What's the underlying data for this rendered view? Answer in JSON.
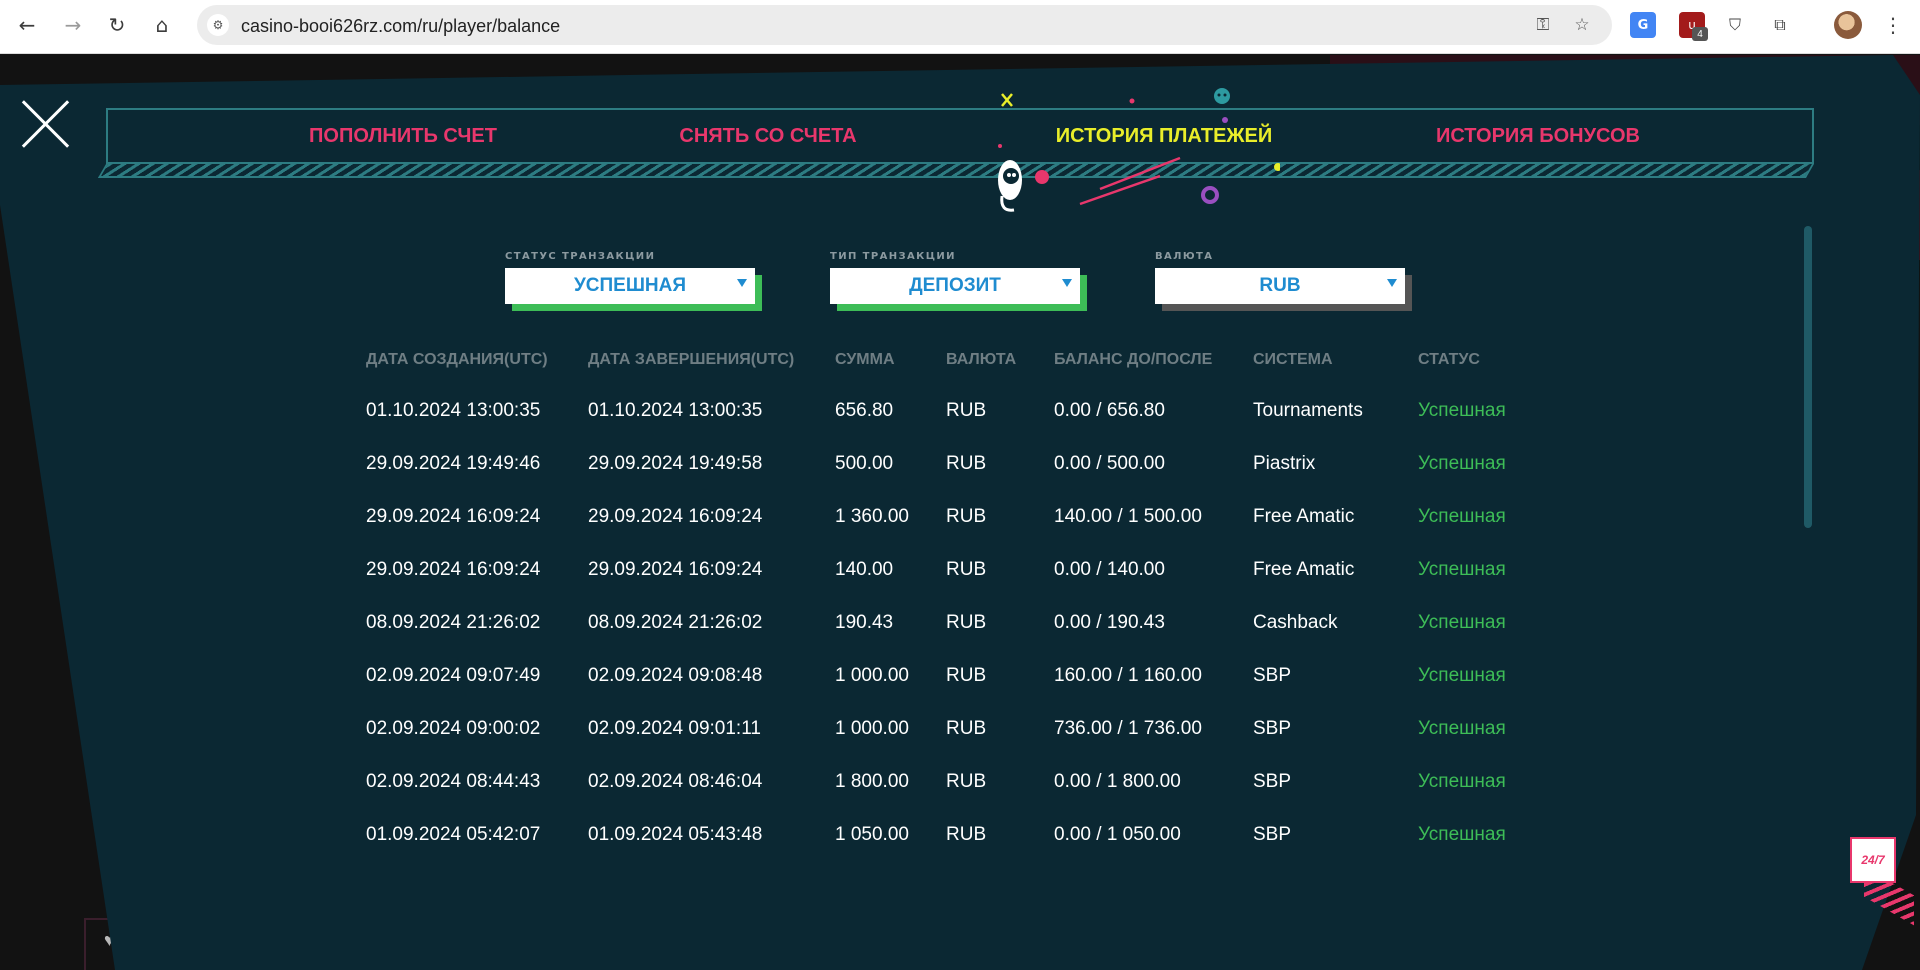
{
  "browser": {
    "url": "casino-booi626rz.com/ru/player/balance",
    "extension_badge": "4",
    "icons": [
      "back-arrow-icon",
      "forward-arrow-icon",
      "reload-icon",
      "home-icon",
      "site-info-icon",
      "key-icon",
      "star-icon",
      "translate-icon",
      "ublock-icon",
      "shield-check-icon",
      "puzzle-icon",
      "kebab-menu-icon"
    ]
  },
  "tabs": [
    {
      "label": "ПОПОЛНИТЬ СЧЕТ",
      "active": false
    },
    {
      "label": "СНЯТЬ СО СЧЕТА",
      "active": false
    },
    {
      "label": "ИСТОРИЯ ПЛАТЕЖЕЙ",
      "active": true
    },
    {
      "label": "ИСТОРИЯ БОНУСОВ",
      "active": false
    }
  ],
  "filters": {
    "status": {
      "label": "СТАТУС ТРАНЗАКЦИИ",
      "value": "УСПЕШНАЯ",
      "shadow_color": "#3dbd57"
    },
    "type": {
      "label": "ТИП ТРАНЗАКЦИИ",
      "value": "ДЕПОЗИТ",
      "shadow_color": "#3dbd57"
    },
    "currency": {
      "label": "ВАЛЮТА",
      "value": "RUB",
      "shadow_color": "#555555"
    }
  },
  "table": {
    "headers": [
      "ДАТА СОЗДАНИЯ(UTC)",
      "ДАТА ЗАВЕРШЕНИЯ(UTC)",
      "СУММА",
      "ВАЛЮТА",
      "БАЛАНС ДО/ПОСЛЕ",
      "СИСТЕМА",
      "СТАТУС"
    ],
    "rows": [
      [
        "01.10.2024 13:00:35",
        "01.10.2024 13:00:35",
        "656.80",
        "RUB",
        "0.00 / 656.80",
        "Tournaments",
        "Успешная"
      ],
      [
        "29.09.2024 19:49:46",
        "29.09.2024 19:49:58",
        "500.00",
        "RUB",
        "0.00 / 500.00",
        "Piastrix",
        "Успешная"
      ],
      [
        "29.09.2024 16:09:24",
        "29.09.2024 16:09:24",
        "1 360.00",
        "RUB",
        "140.00 / 1 500.00",
        "Free Amatic",
        "Успешная"
      ],
      [
        "29.09.2024 16:09:24",
        "29.09.2024 16:09:24",
        "140.00",
        "RUB",
        "0.00 / 140.00",
        "Free Amatic",
        "Успешная"
      ],
      [
        "08.09.2024 21:26:02",
        "08.09.2024 21:26:02",
        "190.43",
        "RUB",
        "0.00 / 190.43",
        "Cashback",
        "Успешная"
      ],
      [
        "02.09.2024 09:07:49",
        "02.09.2024 09:08:48",
        "1 000.00",
        "RUB",
        "160.00 / 1 160.00",
        "SBP",
        "Успешная"
      ],
      [
        "02.09.2024 09:00:02",
        "02.09.2024 09:01:11",
        "1 000.00",
        "RUB",
        "736.00 / 1 736.00",
        "SBP",
        "Успешная"
      ],
      [
        "02.09.2024 08:44:43",
        "02.09.2024 08:46:04",
        "1 800.00",
        "RUB",
        "0.00 / 1 800.00",
        "SBP",
        "Успешная"
      ],
      [
        "01.09.2024 05:42:07",
        "01.09.2024 05:43:48",
        "1 050.00",
        "RUB",
        "0.00 / 1 050.00",
        "SBP",
        "Успешная"
      ]
    ]
  },
  "chat_widget": {
    "label": "24/7"
  },
  "colors": {
    "modal_bg": "#0b2833",
    "tab_inactive": "#e8376c",
    "tab_active": "#e9ee2a",
    "status_success": "#3dbd57",
    "select_text": "#1f8cd0"
  }
}
